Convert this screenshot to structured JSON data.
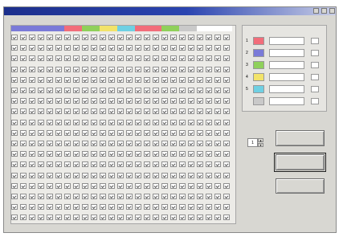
{
  "window": {
    "title": ""
  },
  "matrix": {
    "caption": "",
    "rows": 20,
    "cols": 25,
    "header_colors": [
      "#7a7ad8",
      "#7a7ad8",
      "#7a7ad8",
      "#7a7ad8",
      "#7a7ad8",
      "#7a7ad8",
      "#f26d7a",
      "#f26d7a",
      "#8fd05a",
      "#8fd05a",
      "#f2e36a",
      "#f2e36a",
      "#6fd0e3",
      "#6fd0e3",
      "#f26d7a",
      "#f26d7a",
      "#f26d7a",
      "#8fd05a",
      "#8fd05a",
      "#c9c9c9",
      "#c9c9c9",
      "#ffffff",
      "#ffffff",
      "#ffffff",
      "#ffffff"
    ]
  },
  "legend": {
    "caption": "",
    "headers": [
      "",
      "",
      "",
      ""
    ],
    "rows": [
      {
        "num": "1",
        "color": "#f26d7a",
        "name": ""
      },
      {
        "num": "2",
        "color": "#7a7ad8",
        "name": ""
      },
      {
        "num": "3",
        "color": "#8fd05a",
        "name": ""
      },
      {
        "num": "4",
        "color": "#f2e36a",
        "name": ""
      },
      {
        "num": "5",
        "color": "#6fd0e3",
        "name": ""
      },
      {
        "num": "",
        "color": "#c9c9c9",
        "name": ""
      }
    ]
  },
  "spinner": {
    "label": "",
    "value": "1"
  },
  "buttons": {
    "top": "",
    "save": "",
    "exit": ""
  }
}
